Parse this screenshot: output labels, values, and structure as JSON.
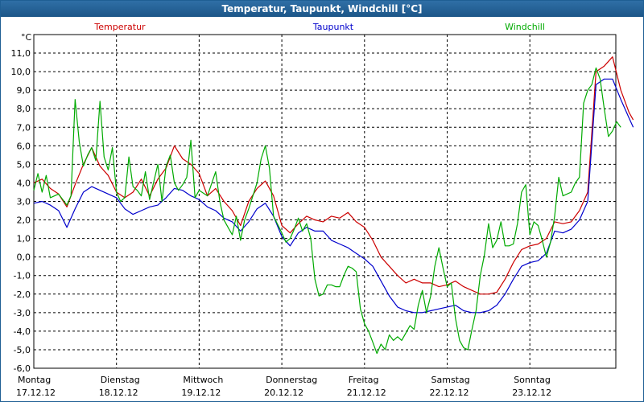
{
  "window": {
    "title": "Temperatur, Taupunkt, Windchill [°C]"
  },
  "chart_data": {
    "type": "line",
    "title": "Temperatur, Taupunkt, Windchill [°C]",
    "ylabel": "°C",
    "ylim": [
      -6,
      12
    ],
    "xlim": [
      0,
      7
    ],
    "y_ticks": [
      "-6,0",
      "-5,0",
      "-4,0",
      "-3,0",
      "-2,0",
      "-1,0",
      "0,0",
      "1,0",
      "2,0",
      "3,0",
      "4,0",
      "5,0",
      "6,0",
      "7,0",
      "8,0",
      "9,0",
      "10,0",
      "11,0"
    ],
    "x_ticks": [
      {
        "day": "Montag",
        "date": "17.12.12"
      },
      {
        "day": "Dienstag",
        "date": "18.12.12"
      },
      {
        "day": "Mittwoch",
        "date": "19.12.12"
      },
      {
        "day": "Donnerstag",
        "date": "20.12.12"
      },
      {
        "day": "Freitag",
        "date": "21.12.12"
      },
      {
        "day": "Samstag",
        "date": "22.12.12"
      },
      {
        "day": "Sonntag",
        "date": "23.12.12"
      }
    ],
    "grid": true,
    "legend_position": "top",
    "series": [
      {
        "name": "Temperatur",
        "color": "#cc0000",
        "points": [
          [
            0.0,
            4.0
          ],
          [
            0.1,
            4.2
          ],
          [
            0.2,
            3.7
          ],
          [
            0.3,
            3.4
          ],
          [
            0.4,
            2.7
          ],
          [
            0.5,
            3.9
          ],
          [
            0.6,
            5.0
          ],
          [
            0.7,
            5.9
          ],
          [
            0.8,
            4.9
          ],
          [
            0.9,
            4.4
          ],
          [
            1.0,
            3.5
          ],
          [
            1.1,
            3.2
          ],
          [
            1.2,
            3.5
          ],
          [
            1.3,
            4.2
          ],
          [
            1.4,
            3.3
          ],
          [
            1.5,
            4.2
          ],
          [
            1.6,
            4.8
          ],
          [
            1.7,
            6.0
          ],
          [
            1.8,
            5.3
          ],
          [
            1.9,
            5.0
          ],
          [
            2.0,
            4.5
          ],
          [
            2.1,
            3.3
          ],
          [
            2.2,
            3.7
          ],
          [
            2.3,
            3.0
          ],
          [
            2.4,
            2.5
          ],
          [
            2.5,
            1.7
          ],
          [
            2.6,
            3.0
          ],
          [
            2.7,
            3.7
          ],
          [
            2.8,
            4.1
          ],
          [
            2.9,
            3.3
          ],
          [
            3.0,
            1.7
          ],
          [
            3.1,
            1.3
          ],
          [
            3.2,
            1.8
          ],
          [
            3.3,
            2.2
          ],
          [
            3.4,
            2.0
          ],
          [
            3.5,
            1.9
          ],
          [
            3.6,
            2.2
          ],
          [
            3.7,
            2.1
          ],
          [
            3.8,
            2.4
          ],
          [
            3.9,
            1.9
          ],
          [
            4.0,
            1.6
          ],
          [
            4.1,
            0.9
          ],
          [
            4.2,
            0.0
          ],
          [
            4.3,
            -0.5
          ],
          [
            4.4,
            -1.0
          ],
          [
            4.5,
            -1.4
          ],
          [
            4.6,
            -1.2
          ],
          [
            4.7,
            -1.4
          ],
          [
            4.8,
            -1.4
          ],
          [
            4.9,
            -1.6
          ],
          [
            5.0,
            -1.5
          ],
          [
            5.1,
            -1.3
          ],
          [
            5.2,
            -1.6
          ],
          [
            5.3,
            -1.8
          ],
          [
            5.4,
            -2.0
          ],
          [
            5.5,
            -2.0
          ],
          [
            5.6,
            -1.9
          ],
          [
            5.7,
            -1.2
          ],
          [
            5.8,
            -0.3
          ],
          [
            5.9,
            0.4
          ],
          [
            6.0,
            0.6
          ],
          [
            6.1,
            0.7
          ],
          [
            6.2,
            1.0
          ],
          [
            6.3,
            1.9
          ],
          [
            6.4,
            1.8
          ],
          [
            6.5,
            1.9
          ],
          [
            6.6,
            2.5
          ],
          [
            6.7,
            3.5
          ],
          [
            6.8,
            10.0
          ],
          [
            6.9,
            10.3
          ],
          [
            7.0,
            10.8
          ],
          [
            7.1,
            9.0
          ],
          [
            7.2,
            7.8
          ],
          [
            7.25,
            7.4
          ]
        ]
      },
      {
        "name": "Taupunkt",
        "color": "#0000cc",
        "points": [
          [
            0.0,
            2.9
          ],
          [
            0.1,
            3.0
          ],
          [
            0.2,
            2.8
          ],
          [
            0.3,
            2.5
          ],
          [
            0.4,
            1.6
          ],
          [
            0.5,
            2.6
          ],
          [
            0.6,
            3.5
          ],
          [
            0.7,
            3.8
          ],
          [
            0.8,
            3.6
          ],
          [
            0.9,
            3.4
          ],
          [
            1.0,
            3.2
          ],
          [
            1.1,
            2.6
          ],
          [
            1.2,
            2.3
          ],
          [
            1.3,
            2.5
          ],
          [
            1.4,
            2.7
          ],
          [
            1.5,
            2.8
          ],
          [
            1.6,
            3.2
          ],
          [
            1.7,
            3.7
          ],
          [
            1.8,
            3.6
          ],
          [
            1.9,
            3.3
          ],
          [
            2.0,
            3.1
          ],
          [
            2.1,
            2.7
          ],
          [
            2.2,
            2.5
          ],
          [
            2.3,
            2.1
          ],
          [
            2.4,
            1.9
          ],
          [
            2.5,
            1.4
          ],
          [
            2.6,
            1.9
          ],
          [
            2.7,
            2.6
          ],
          [
            2.8,
            2.9
          ],
          [
            2.9,
            2.2
          ],
          [
            3.0,
            1.1
          ],
          [
            3.1,
            0.6
          ],
          [
            3.2,
            1.3
          ],
          [
            3.3,
            1.6
          ],
          [
            3.4,
            1.4
          ],
          [
            3.5,
            1.4
          ],
          [
            3.6,
            0.9
          ],
          [
            3.7,
            0.7
          ],
          [
            3.8,
            0.5
          ],
          [
            3.9,
            0.2
          ],
          [
            4.0,
            -0.1
          ],
          [
            4.1,
            -0.5
          ],
          [
            4.2,
            -1.3
          ],
          [
            4.3,
            -2.1
          ],
          [
            4.4,
            -2.7
          ],
          [
            4.5,
            -2.9
          ],
          [
            4.6,
            -3.0
          ],
          [
            4.7,
            -3.0
          ],
          [
            4.8,
            -2.9
          ],
          [
            4.9,
            -2.8
          ],
          [
            5.0,
            -2.7
          ],
          [
            5.1,
            -2.6
          ],
          [
            5.2,
            -2.9
          ],
          [
            5.3,
            -3.0
          ],
          [
            5.4,
            -3.0
          ],
          [
            5.5,
            -2.9
          ],
          [
            5.6,
            -2.6
          ],
          [
            5.7,
            -2.0
          ],
          [
            5.8,
            -1.2
          ],
          [
            5.9,
            -0.5
          ],
          [
            6.0,
            -0.3
          ],
          [
            6.1,
            -0.2
          ],
          [
            6.2,
            0.2
          ],
          [
            6.3,
            1.4
          ],
          [
            6.4,
            1.3
          ],
          [
            6.5,
            1.5
          ],
          [
            6.6,
            2.0
          ],
          [
            6.7,
            3.0
          ],
          [
            6.8,
            9.3
          ],
          [
            6.9,
            9.6
          ],
          [
            7.0,
            9.6
          ],
          [
            7.1,
            8.5
          ],
          [
            7.2,
            7.5
          ],
          [
            7.25,
            7.0
          ]
        ]
      },
      {
        "name": "Windchill",
        "color": "#00aa00",
        "points": [
          [
            0.0,
            3.6
          ],
          [
            0.05,
            4.5
          ],
          [
            0.1,
            3.5
          ],
          [
            0.15,
            4.4
          ],
          [
            0.2,
            3.2
          ],
          [
            0.3,
            3.4
          ],
          [
            0.4,
            2.8
          ],
          [
            0.45,
            3.3
          ],
          [
            0.5,
            8.5
          ],
          [
            0.55,
            6.2
          ],
          [
            0.6,
            4.9
          ],
          [
            0.65,
            5.5
          ],
          [
            0.7,
            5.9
          ],
          [
            0.75,
            5.2
          ],
          [
            0.8,
            8.4
          ],
          [
            0.85,
            5.4
          ],
          [
            0.9,
            4.7
          ],
          [
            0.95,
            5.9
          ],
          [
            1.0,
            3.5
          ],
          [
            1.05,
            3.0
          ],
          [
            1.1,
            3.2
          ],
          [
            1.15,
            5.4
          ],
          [
            1.2,
            3.8
          ],
          [
            1.25,
            3.6
          ],
          [
            1.3,
            3.3
          ],
          [
            1.35,
            4.6
          ],
          [
            1.4,
            3.1
          ],
          [
            1.5,
            5.0
          ],
          [
            1.55,
            3.0
          ],
          [
            1.6,
            4.9
          ],
          [
            1.65,
            5.5
          ],
          [
            1.7,
            4.0
          ],
          [
            1.75,
            3.6
          ],
          [
            1.8,
            3.9
          ],
          [
            1.85,
            4.3
          ],
          [
            1.9,
            6.3
          ],
          [
            1.95,
            3.2
          ],
          [
            2.0,
            3.6
          ],
          [
            2.1,
            3.3
          ],
          [
            2.2,
            4.6
          ],
          [
            2.25,
            3.0
          ],
          [
            2.3,
            2.0
          ],
          [
            2.35,
            1.6
          ],
          [
            2.4,
            1.2
          ],
          [
            2.45,
            2.2
          ],
          [
            2.5,
            0.9
          ],
          [
            2.55,
            2.0
          ],
          [
            2.6,
            2.6
          ],
          [
            2.7,
            4.0
          ],
          [
            2.75,
            5.3
          ],
          [
            2.8,
            6.0
          ],
          [
            2.85,
            4.8
          ],
          [
            2.9,
            2.2
          ],
          [
            3.0,
            1.3
          ],
          [
            3.05,
            0.8
          ],
          [
            3.1,
            1.0
          ],
          [
            3.15,
            1.5
          ],
          [
            3.2,
            2.1
          ],
          [
            3.25,
            1.4
          ],
          [
            3.3,
            1.8
          ],
          [
            3.35,
            1.0
          ],
          [
            3.4,
            -1.2
          ],
          [
            3.45,
            -2.1
          ],
          [
            3.5,
            -2.0
          ],
          [
            3.55,
            -1.5
          ],
          [
            3.6,
            -1.5
          ],
          [
            3.65,
            -1.6
          ],
          [
            3.7,
            -1.6
          ],
          [
            3.75,
            -1.0
          ],
          [
            3.8,
            -0.5
          ],
          [
            3.85,
            -0.6
          ],
          [
            3.9,
            -0.8
          ],
          [
            3.95,
            -2.8
          ],
          [
            4.0,
            -3.6
          ],
          [
            4.05,
            -4.0
          ],
          [
            4.1,
            -4.6
          ],
          [
            4.15,
            -5.2
          ],
          [
            4.2,
            -4.7
          ],
          [
            4.25,
            -5.0
          ],
          [
            4.3,
            -4.2
          ],
          [
            4.35,
            -4.5
          ],
          [
            4.4,
            -4.3
          ],
          [
            4.45,
            -4.5
          ],
          [
            4.5,
            -4.1
          ],
          [
            4.55,
            -3.7
          ],
          [
            4.6,
            -3.9
          ],
          [
            4.65,
            -2.6
          ],
          [
            4.7,
            -1.8
          ],
          [
            4.75,
            -3.0
          ],
          [
            4.8,
            -2.1
          ],
          [
            4.85,
            -0.5
          ],
          [
            4.9,
            0.5
          ],
          [
            4.95,
            -0.6
          ],
          [
            5.0,
            -1.6
          ],
          [
            5.05,
            -1.4
          ],
          [
            5.1,
            -3.3
          ],
          [
            5.15,
            -4.5
          ],
          [
            5.2,
            -4.9
          ],
          [
            5.25,
            -5.0
          ],
          [
            5.3,
            -3.9
          ],
          [
            5.35,
            -2.9
          ],
          [
            5.4,
            -1.0
          ],
          [
            5.45,
            0.1
          ],
          [
            5.5,
            1.8
          ],
          [
            5.55,
            0.5
          ],
          [
            5.6,
            0.9
          ],
          [
            5.65,
            1.9
          ],
          [
            5.7,
            0.6
          ],
          [
            5.75,
            0.6
          ],
          [
            5.8,
            0.7
          ],
          [
            5.85,
            1.8
          ],
          [
            5.9,
            3.5
          ],
          [
            5.95,
            3.9
          ],
          [
            6.0,
            1.2
          ],
          [
            6.05,
            1.9
          ],
          [
            6.1,
            1.7
          ],
          [
            6.15,
            0.9
          ],
          [
            6.2,
            0.0
          ],
          [
            6.25,
            0.8
          ],
          [
            6.3,
            2.2
          ],
          [
            6.35,
            4.3
          ],
          [
            6.4,
            3.3
          ],
          [
            6.5,
            3.5
          ],
          [
            6.55,
            4.0
          ],
          [
            6.6,
            4.3
          ],
          [
            6.65,
            8.3
          ],
          [
            6.7,
            9.0
          ],
          [
            6.75,
            9.3
          ],
          [
            6.8,
            10.2
          ],
          [
            6.85,
            9.6
          ],
          [
            6.9,
            8.0
          ],
          [
            6.95,
            6.5
          ],
          [
            7.0,
            6.8
          ],
          [
            7.05,
            7.3
          ],
          [
            7.1,
            7.0
          ]
        ]
      }
    ]
  }
}
